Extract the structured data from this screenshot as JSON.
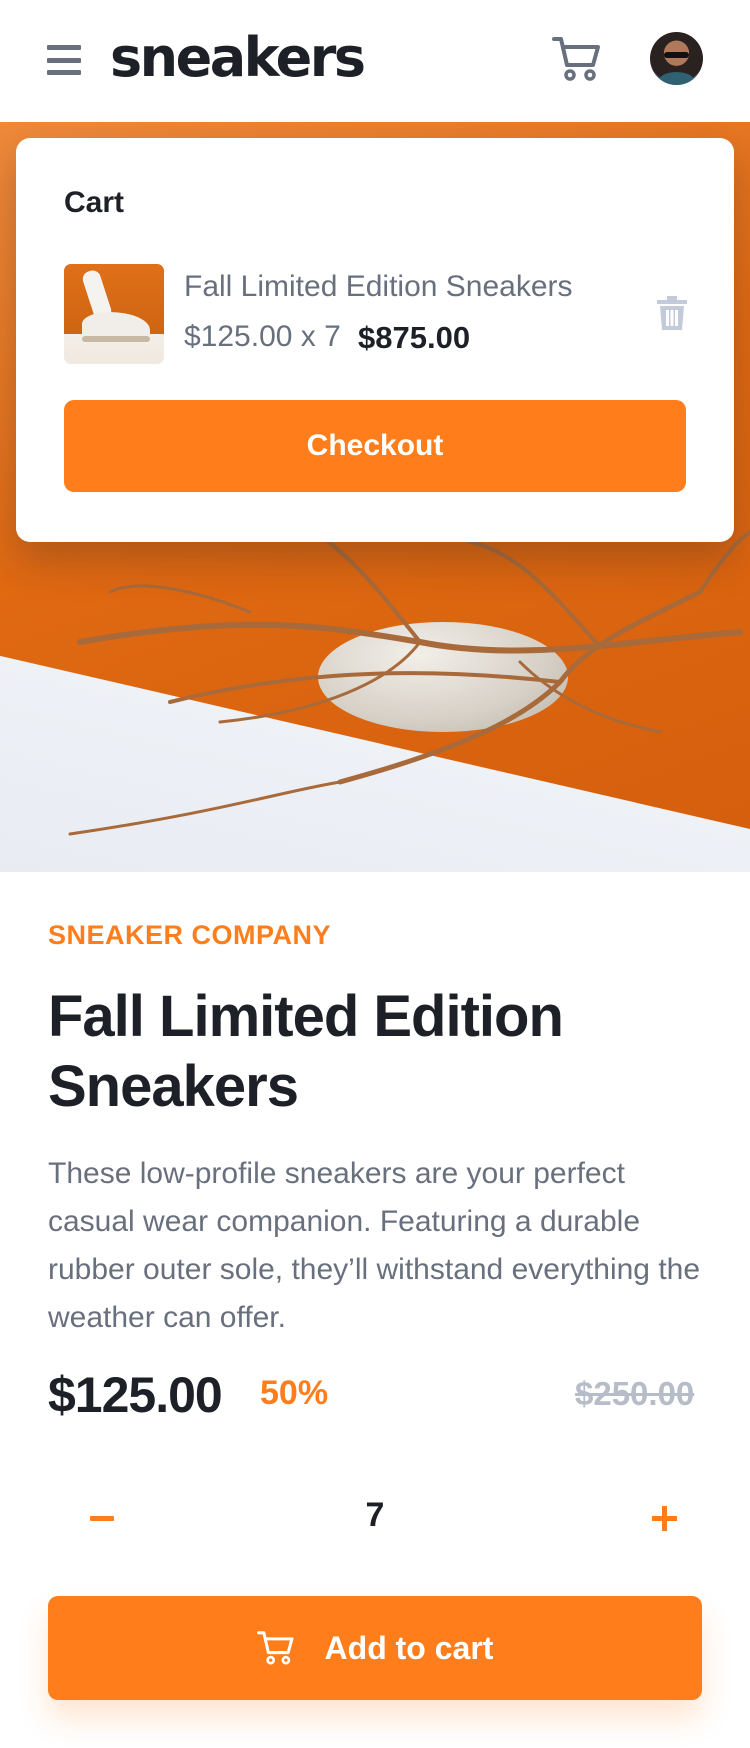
{
  "header": {
    "logo": "sneakers",
    "menu_icon": "hamburger-menu-icon",
    "cart_icon": "cart-icon",
    "avatar": "user-avatar"
  },
  "cart": {
    "title": "Cart",
    "item": {
      "name": "Fall Limited Edition Sneakers",
      "unit_price_qty": "$125.00 x 7",
      "total": "$875.00",
      "delete_icon": "trash-icon"
    },
    "checkout_label": "Checkout"
  },
  "product": {
    "company": "Sneaker Company",
    "title": "Fall Limited Edition Sneakers",
    "description": "These low-profile sneakers are your perfect casual wear companion. Featuring a durable rubber outer sole, they’ll withstand everything the weather can offer.",
    "price": "$125.00",
    "discount": "50%",
    "original_price": "$250.00"
  },
  "quantity": {
    "value": "7",
    "minus_icon": "minus-icon",
    "plus_icon": "plus-icon"
  },
  "add_to_cart": {
    "label": "Add to cart",
    "icon": "cart-icon"
  },
  "colors": {
    "accent": "#ff7e1b",
    "text_dark": "#1d2026",
    "text_muted": "#69707d",
    "text_light": "#b6bcc8"
  }
}
